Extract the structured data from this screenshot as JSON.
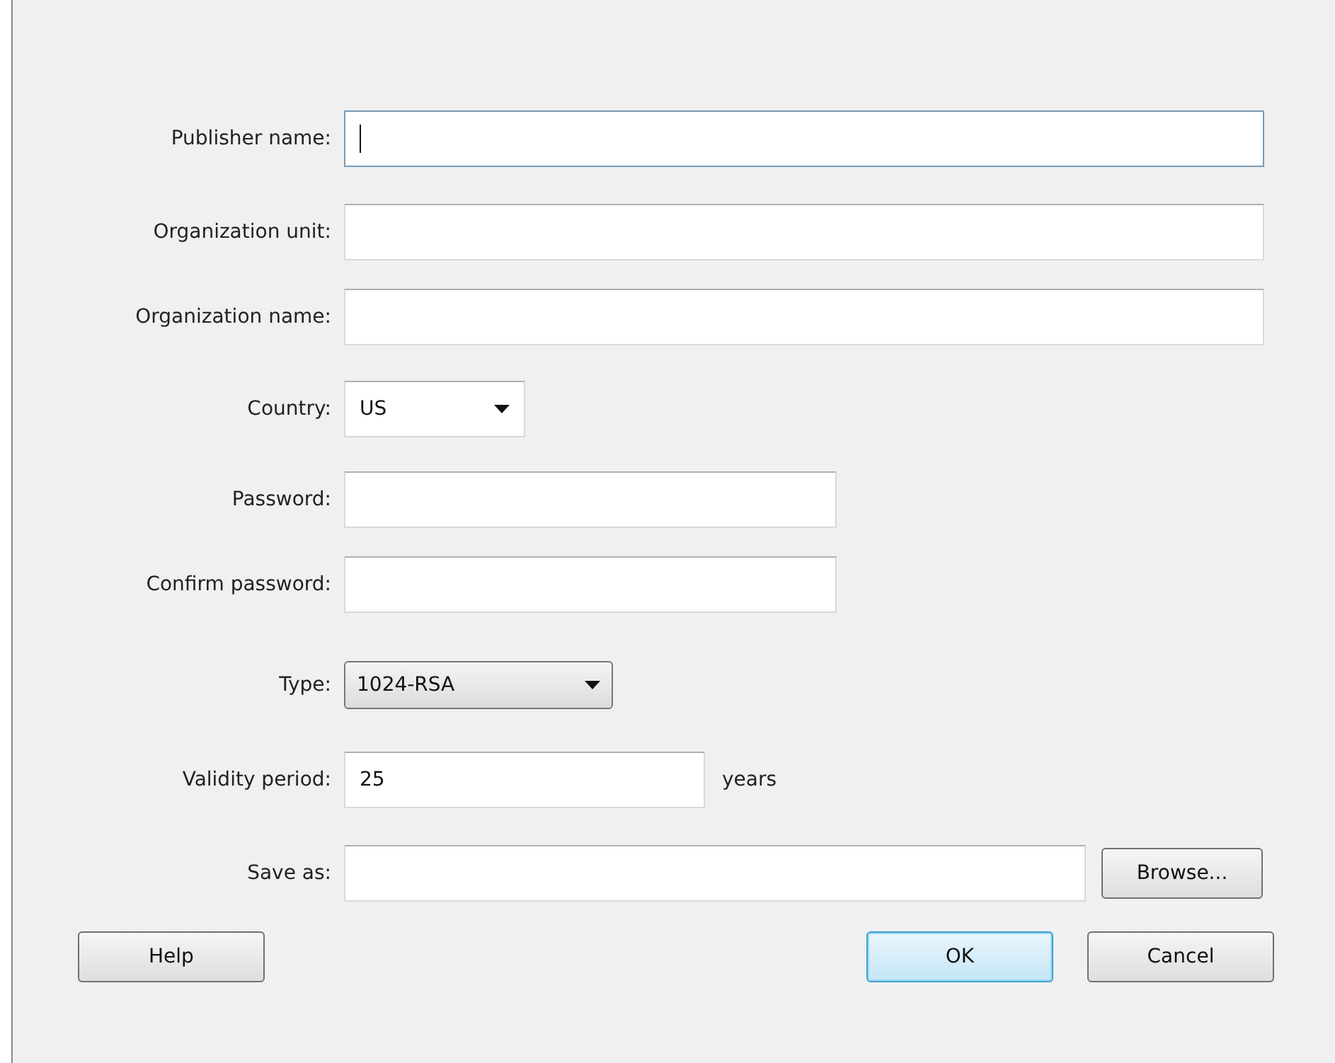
{
  "fields": [
    {
      "label": "Publisher name:",
      "kind": "text",
      "focused": true
    },
    {
      "label": "Organization unit:",
      "kind": "text",
      "focused": false
    },
    {
      "label": "Organization name:",
      "kind": "text",
      "focused": false
    },
    {
      "label": "Country:",
      "kind": "select",
      "value": "US"
    },
    {
      "label": "Password:",
      "kind": "password",
      "focused": false
    },
    {
      "label": "Confirm password:",
      "kind": "password",
      "focused": false
    },
    {
      "label": "Type:",
      "kind": "combo",
      "value": "1024-RSA"
    },
    {
      "label": "Validity period:",
      "kind": "text",
      "value": "25",
      "suffix": "years",
      "focused": false
    },
    {
      "label": "Save as:",
      "kind": "text",
      "button": "Browse...",
      "focused": false
    }
  ],
  "buttons": [
    {
      "label": "Help",
      "default": false
    },
    {
      "label": "OK",
      "default": true
    },
    {
      "label": "Cancel",
      "default": false
    }
  ]
}
